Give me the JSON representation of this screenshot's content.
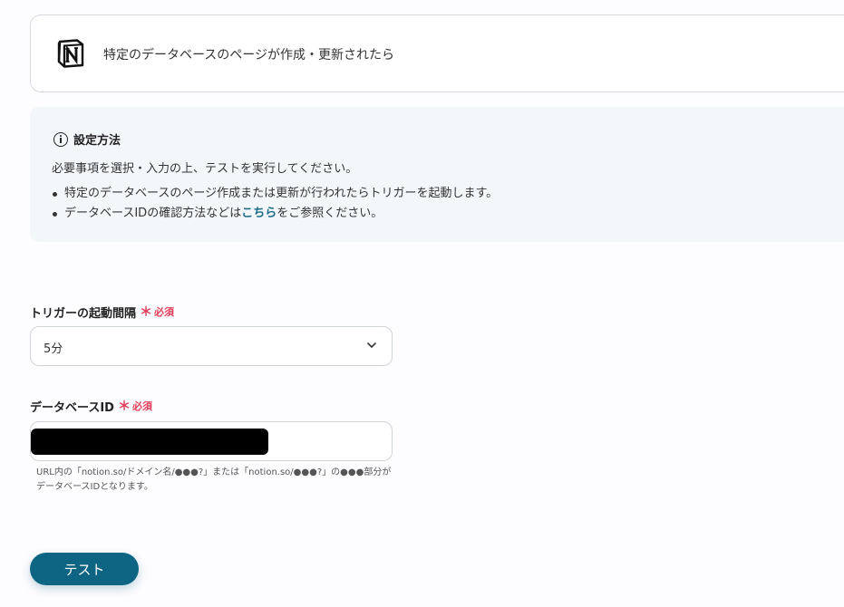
{
  "trigger": {
    "app_icon": "notion-logo-icon",
    "title": "特定のデータベースのページが作成・更新されたら"
  },
  "info": {
    "icon": "info-icon",
    "title": "設定方法",
    "description": "必要事項を選択・入力の上、テストを実行してください。",
    "bullet1": "特定のデータベースのページ作成または更新が行われたらトリガーを起動します。",
    "bullet2_prefix": "データベースIDの確認方法などは",
    "bullet2_link": "こちら",
    "bullet2_suffix": "をご参照ください。"
  },
  "interval_field": {
    "label": "トリガーの起動間隔",
    "required_mark": "＊",
    "required_text": "必須",
    "value": "5分"
  },
  "database_field": {
    "label": "データベースID",
    "required_mark": "＊",
    "required_text": "必須",
    "value": "",
    "help": "URL内の「notion.so/ドメイン名/●●●?」または「notion.so/●●●?」の●●●部分がデータベースIDとなります。"
  },
  "actions": {
    "test_label": "テスト"
  },
  "colors": {
    "primary": "#0d6483",
    "required": "#e0405a",
    "link": "#1a6b8a",
    "info_bg": "#f4f7fa"
  }
}
